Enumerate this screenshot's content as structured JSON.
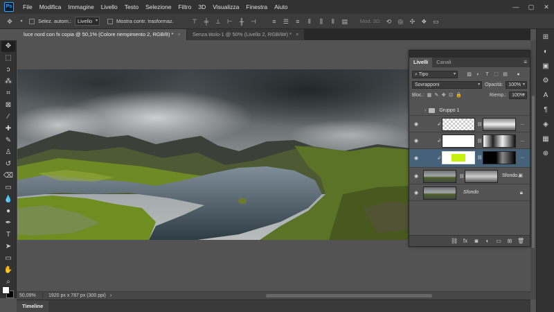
{
  "app": {
    "logo": "Ps"
  },
  "menu": [
    "File",
    "Modifica",
    "Immagine",
    "Livello",
    "Testo",
    "Selezione",
    "Filtro",
    "3D",
    "Visualizza",
    "Finestra",
    "Aiuto"
  ],
  "window_controls": {
    "minimize": "—",
    "maximize": "▢",
    "close": "✕"
  },
  "options": {
    "auto_select_label": "Selez. autom.:",
    "auto_select_value": "Livello",
    "show_transform_label": "Mostra contr. trasformaz.",
    "mode_3d_label": "Mod. 3D:"
  },
  "tabs": [
    {
      "title": "luce nord con fx copia @ 50,1% (Colore riempimento 2, RGB/8) *",
      "close": "×",
      "active": true
    },
    {
      "title": "Senza titolo-1 @ 50% (Livello 2, RGB/8#) *",
      "close": "×",
      "active": false
    }
  ],
  "status": {
    "zoom": "50,09%",
    "doc_info": "1920 px x 787 px (300 ppi)"
  },
  "timeline": {
    "label": "Timeline"
  },
  "layers_panel": {
    "tabs": [
      "Livelli",
      "Canali"
    ],
    "menu_icon": "≡",
    "filter_label": "Tipo",
    "blend_mode": "Sovrapponi",
    "opacity_label": "Opacità:",
    "opacity_value": "100%",
    "lock_label": "Bloc.:",
    "fill_label": "Riemp.:",
    "fill_value": "100%",
    "group_name": "Gruppo 1",
    "layer_names": [
      "Sfondo...",
      "Sfondo"
    ],
    "more": "..."
  },
  "colors": {
    "selected_layer": "#46627b",
    "fill_swatch": "#c6f00e",
    "accent": "#31a8ff"
  }
}
